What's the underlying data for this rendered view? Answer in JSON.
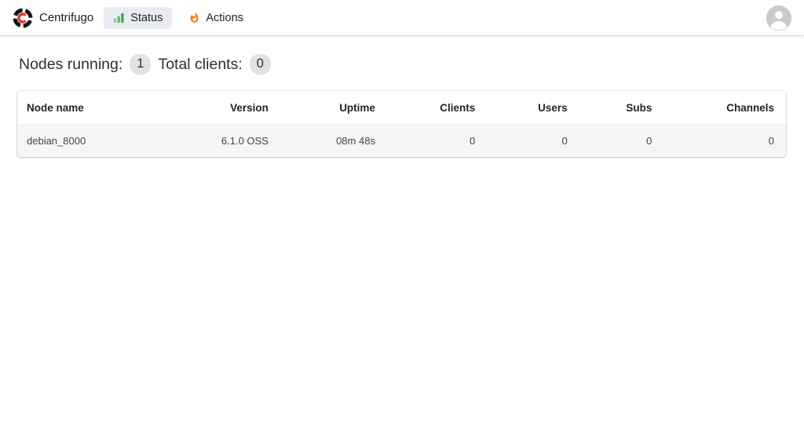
{
  "navbar": {
    "brand": "Centrifugo",
    "tabs": [
      {
        "label": "Status",
        "active": true
      },
      {
        "label": "Actions",
        "active": false
      }
    ],
    "icons": {
      "logo": "centrifugo-logo",
      "status": "bar-chart-icon",
      "actions": "fire-icon",
      "user": "person-avatar-icon"
    }
  },
  "summary": {
    "nodes_running_label": "Nodes running:",
    "nodes_running_value": "1",
    "total_clients_label": "Total clients:",
    "total_clients_value": "0"
  },
  "table": {
    "headers": [
      "Node name",
      "Version",
      "Uptime",
      "Clients",
      "Users",
      "Subs",
      "Channels"
    ],
    "rows": [
      [
        "debian_8000",
        "6.1.0 OSS",
        "08m 48s",
        "0",
        "0",
        "0",
        "0"
      ]
    ]
  },
  "colors": {
    "active_tab_bg": "#e9ecf3",
    "badge_bg": "#e2e2e4",
    "row_bg": "#f6f6f7",
    "logo_red": "#e0382a",
    "chart_green": "#43a047",
    "fire_orange": "#f6820d",
    "avatar_gray": "#c9c9c9"
  }
}
